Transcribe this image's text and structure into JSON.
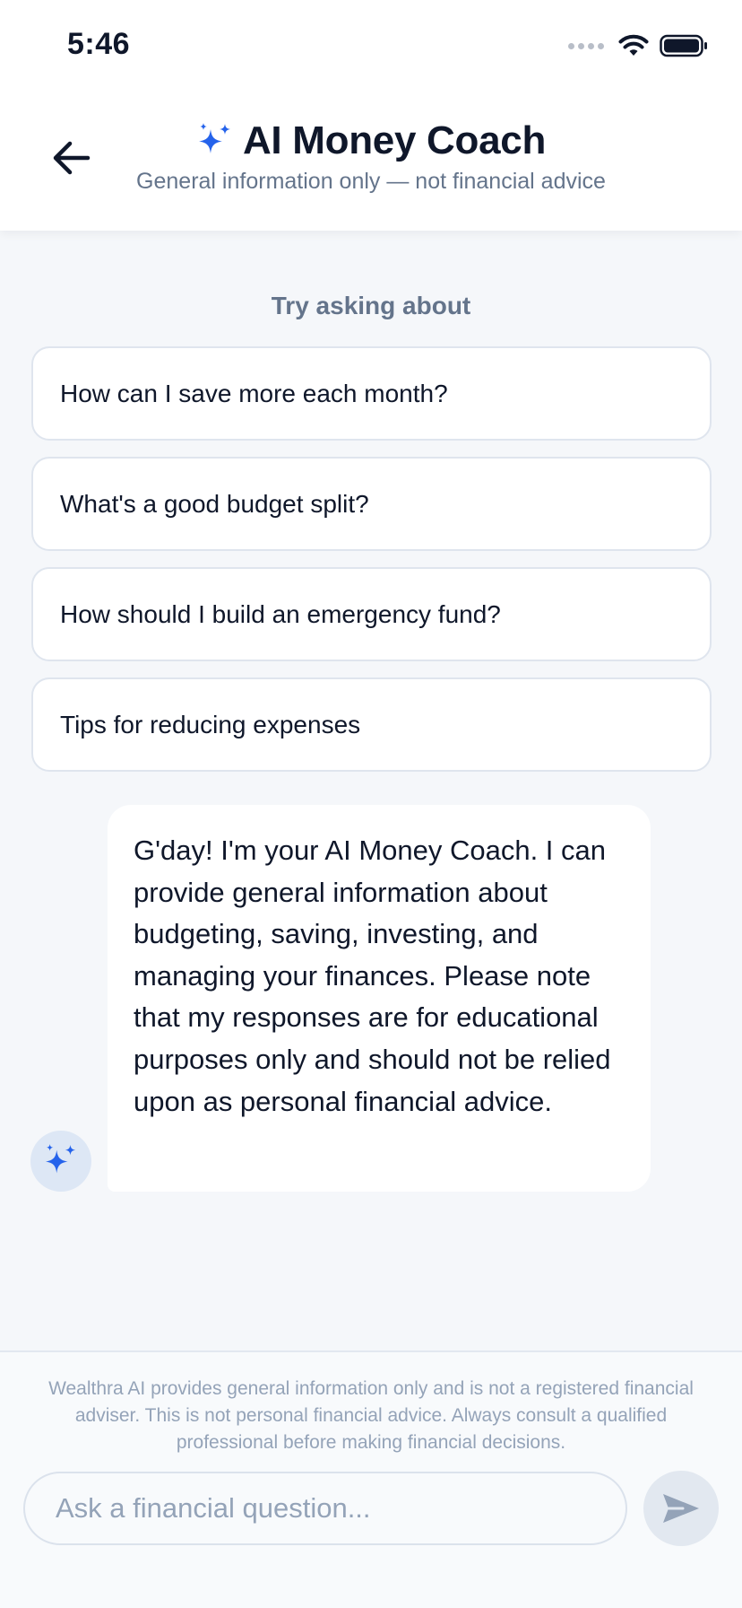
{
  "status_bar": {
    "time": "5:46",
    "icons": [
      "cellular-signal-icon",
      "wifi-icon",
      "battery-icon"
    ]
  },
  "header": {
    "back_icon": "arrow-left-icon",
    "title_icon": "sparkles-icon",
    "title": "AI Money Coach",
    "subtitle": "General information only — not financial advice"
  },
  "suggestions": {
    "label": "Try asking about",
    "items": [
      "How can I save more each month?",
      "What's a good budget split?",
      "How should I build an emergency fund?",
      "Tips for reducing expenses"
    ]
  },
  "messages": [
    {
      "sender": "assistant",
      "avatar_icon": "sparkles-icon",
      "text": "G'day! I'm your AI Money Coach. I can provide general information about budgeting, saving, investing, and managing your finances. Please note that my responses are for educational purposes only and should not be relied upon as personal financial advice."
    }
  ],
  "footer": {
    "disclaimer": "Wealthra AI provides general information only and is not a registered financial adviser. This is not personal financial advice. Always consult a qualified professional before making financial decisions.",
    "input_placeholder": "Ask a financial question...",
    "input_value": "",
    "send_icon": "send-icon"
  },
  "colors": {
    "accent": "#2563eb",
    "text_primary": "#0f172a",
    "text_muted": "#64748b",
    "background": "#f5f7fa",
    "send_button_disabled": "#e2e8f0"
  }
}
